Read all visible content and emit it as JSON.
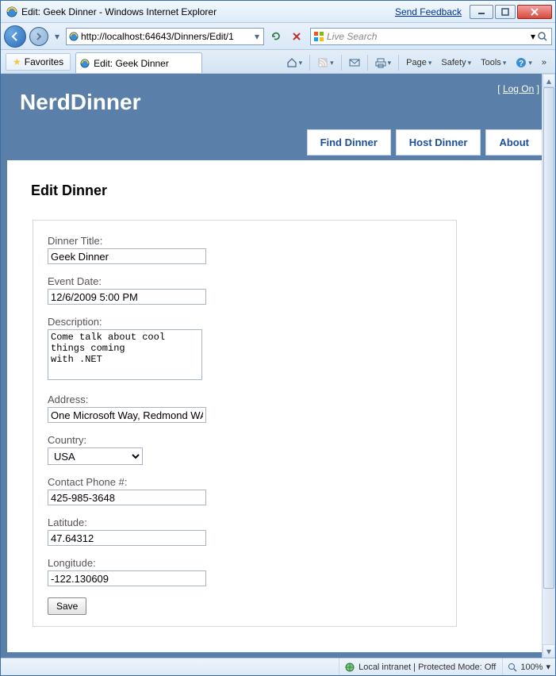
{
  "window": {
    "title": "Edit: Geek Dinner - Windows Internet Explorer",
    "feedback": "Send Feedback"
  },
  "nav": {
    "url": "http://localhost:64643/Dinners/Edit/1",
    "search_placeholder": "Live Search"
  },
  "tabrow": {
    "favorites": "Favorites",
    "tab_title": "Edit: Geek Dinner"
  },
  "cmdbar": {
    "page": "Page",
    "safety": "Safety",
    "tools": "Tools"
  },
  "site": {
    "logo": "NerdDinner",
    "logon_left": "[",
    "logon_link": "Log On",
    "logon_right": "]",
    "nav": {
      "find": "Find Dinner",
      "host": "Host Dinner",
      "about": "About"
    }
  },
  "page": {
    "heading": "Edit Dinner",
    "labels": {
      "title": "Dinner Title:",
      "date": "Event Date:",
      "desc": "Description:",
      "address": "Address:",
      "country": "Country:",
      "phone": "Contact Phone #:",
      "lat": "Latitude:",
      "lon": "Longitude:"
    },
    "values": {
      "title": "Geek Dinner",
      "date": "12/6/2009 5:00 PM",
      "desc": "Come talk about cool things coming\nwith .NET",
      "address": "One Microsoft Way, Redmond WA",
      "country": "USA",
      "phone": "425-985-3648",
      "lat": "47.64312",
      "lon": "-122.130609"
    },
    "save": "Save"
  },
  "status": {
    "zone": "Local intranet | Protected Mode: Off",
    "zoom": "100%"
  }
}
